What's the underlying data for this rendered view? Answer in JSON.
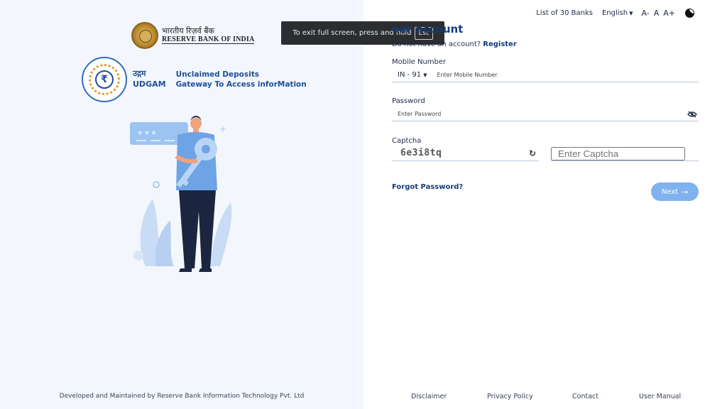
{
  "brand": {
    "rbi_hindi": "भारतीय रिज़र्व बैंक",
    "rbi_english": "RESERVE BANK OF INDIA",
    "udgam_hindi": "उद्गम",
    "udgam_english": "UDGAM",
    "udgam_full_line1": "Unclaimed Deposits",
    "udgam_full_line2": "Gateway To Access inforMation",
    "rupee_symbol": "₹"
  },
  "left_footer": "Developed and Maintained by Reserve Bank Information Technology Pvt. Ltd",
  "topbar": {
    "banks_link": "List of 30 Banks",
    "language": "English",
    "font_decrease": "A-",
    "font_normal": "A",
    "font_increase": "A+",
    "theme_icon": "half-moon-icon"
  },
  "toast": {
    "message": "To exit full screen, press and hold",
    "key": "Esc"
  },
  "login": {
    "title": "our account",
    "register_prompt": "Do not have an account?",
    "register_link": "Register",
    "mobile_label": "Mobile Number",
    "country_code": "IN - 91",
    "mobile_placeholder": "Enter Mobile Number",
    "password_label": "Password",
    "password_placeholder": "Enter Password",
    "captcha_label": "Captcha",
    "captcha_value": "6e3i8tq",
    "captcha_placeholder": "Enter Captcha",
    "forgot_password": "Forgot Password?",
    "next_label": "Next"
  },
  "right_footer": {
    "disclaimer": "Disclaimer",
    "privacy": "Privacy Policy",
    "contact": "Contact",
    "manual": "User Manual"
  },
  "colors": {
    "primary": "#173a78",
    "button": "#7fb2ee",
    "left_bg": "#f3f7fd"
  }
}
